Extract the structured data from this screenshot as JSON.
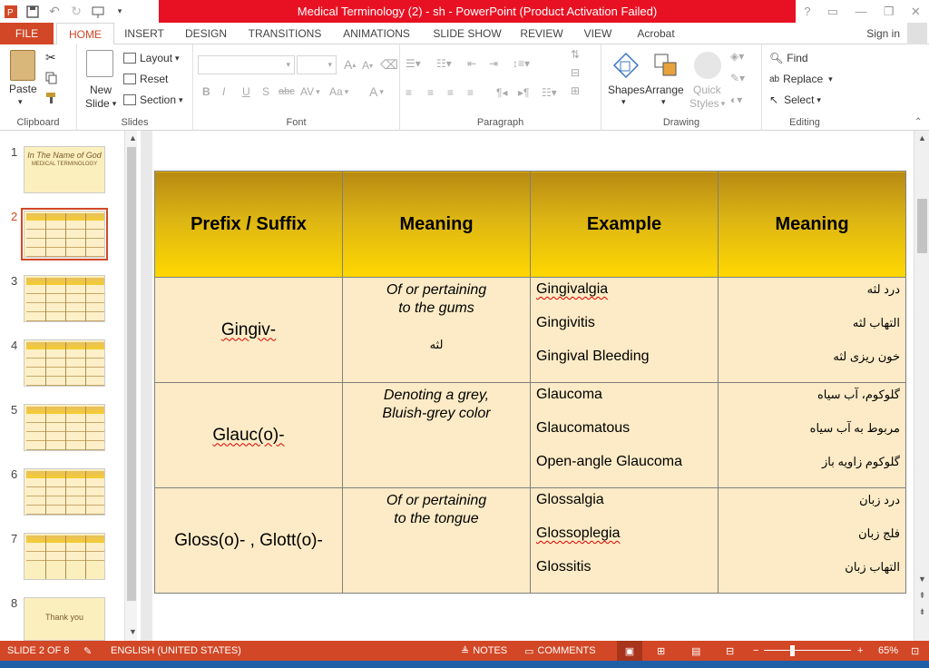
{
  "window": {
    "title": "Medical Terminology (2) - sh -  PowerPoint (Product Activation Failed)",
    "controls": [
      "?",
      "▭",
      "—",
      "❐",
      "✕"
    ]
  },
  "qat": {
    "icons": [
      "powerpoint-logo-icon",
      "save-icon",
      "undo-icon",
      "redo-icon",
      "start-slideshow-icon",
      "customize-qat-icon"
    ]
  },
  "tabs": [
    {
      "label": "FILE"
    },
    {
      "label": "HOME"
    },
    {
      "label": "INSERT"
    },
    {
      "label": "DESIGN"
    },
    {
      "label": "TRANSITIONS"
    },
    {
      "label": "ANIMATIONS"
    },
    {
      "label": "SLIDE SHOW"
    },
    {
      "label": "REVIEW"
    },
    {
      "label": "VIEW"
    },
    {
      "label": "Acrobat"
    }
  ],
  "signin": "Sign in",
  "ribbon": {
    "clipboard": {
      "label": "Clipboard",
      "paste": "Paste"
    },
    "slides": {
      "label": "Slides",
      "new_slide": "New Slide",
      "new_slide_line1": "New",
      "new_slide_line2": "Slide",
      "layout": "Layout",
      "reset": "Reset",
      "section": "Section"
    },
    "font": {
      "label": "Font",
      "bold": "B",
      "italic": "I",
      "underline": "U",
      "shadow": "S",
      "strike": "abc",
      "spacing": "AV",
      "case": "Aa",
      "color": "A"
    },
    "paragraph": {
      "label": "Paragraph"
    },
    "drawing": {
      "label": "Drawing",
      "shapes": "Shapes",
      "arrange": "Arrange",
      "quick_styles_1": "Quick",
      "quick_styles_2": "Styles"
    },
    "editing": {
      "label": "Editing",
      "find": "Find",
      "replace": "Replace",
      "select": "Select"
    }
  },
  "thumbnails": [
    {
      "num": "1",
      "title": "In The Name of God",
      "subtitle": "MEDICAL TERMINOLOGY"
    },
    {
      "num": "2"
    },
    {
      "num": "3"
    },
    {
      "num": "4"
    },
    {
      "num": "5"
    },
    {
      "num": "6"
    },
    {
      "num": "7"
    },
    {
      "num": "8",
      "title": "Thank you"
    }
  ],
  "table": {
    "headers": [
      "Prefix / Suffix",
      "Meaning",
      "Example",
      "Meaning"
    ],
    "rows": [
      {
        "prefix": "Gingiv-",
        "meaning_en_1": "Of or pertaining",
        "meaning_en_2": "to the gums",
        "meaning_fa": "لثه",
        "examples": [
          "Gingivalgia",
          "Gingivitis",
          "Gingival Bleeding"
        ],
        "fa": [
          "درد لثه",
          "التهاب لثه",
          "خون ریزی لثه"
        ]
      },
      {
        "prefix": "Glauc(o)-",
        "meaning_en_1": "Denoting a grey,",
        "meaning_en_2": "Bluish-grey color",
        "meaning_fa": "",
        "examples": [
          "Glaucoma",
          "Glaucomatous",
          "Open-angle Glaucoma"
        ],
        "fa": [
          "گلوکوم، آب سیاه",
          "مربوط به آب سیاه",
          "گلوکوم زاویه باز"
        ]
      },
      {
        "prefix": "Gloss(o)- , Glott(o)-",
        "meaning_en_1": "Of or pertaining",
        "meaning_en_2": "to the tongue",
        "meaning_fa": "",
        "examples": [
          "Glossalgia",
          "Glossoplegia",
          "Glossitis"
        ],
        "fa": [
          "درد زبان",
          "فلج زبان",
          "التهاب زبان"
        ]
      }
    ]
  },
  "status": {
    "slide": "SLIDE 2 OF 8",
    "language": "ENGLISH (UNITED STATES)",
    "notes": "NOTES",
    "comments": "COMMENTS",
    "zoom": "65%"
  },
  "colors": {
    "accent": "#d24726",
    "title_bar": "#e81123",
    "header_gold": "#ffd800",
    "cell_bg": "#fcebc6"
  }
}
